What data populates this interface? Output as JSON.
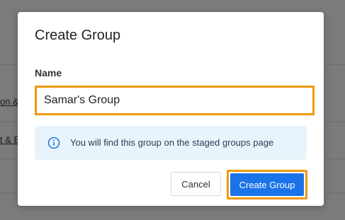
{
  "background": {
    "links": [
      "on &",
      "t & E"
    ]
  },
  "dialog": {
    "title": "Create Group",
    "name_label": "Name",
    "name_value": "Samar's Group",
    "info_text": "You will find this group on the staged groups page",
    "cancel_label": "Cancel",
    "create_label": "Create Group",
    "info_icon": "info-circle-icon"
  },
  "colors": {
    "focus_outline": "#f0980d",
    "primary_button": "#1a73e8",
    "info_background": "#e8f3fb",
    "info_icon": "#2b7fd8"
  }
}
